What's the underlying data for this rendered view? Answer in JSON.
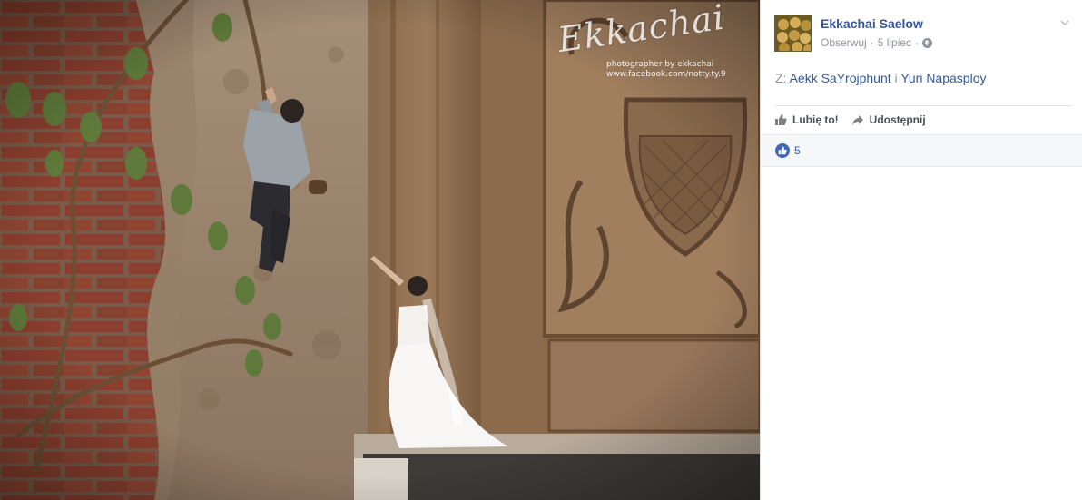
{
  "photo": {
    "watermark_signature": "Ekkachai",
    "watermark_credit": "photographer by ekkachai",
    "watermark_url": "www.facebook.com/notty.ty.9"
  },
  "post": {
    "author": "Ekkachai Saelow",
    "follow_label": "Obserwuj",
    "separator": "·",
    "date": "5 lipiec",
    "with_prefix": "Z:",
    "tagged": [
      "Aekk SaYrojphunt",
      "Yuri Napasploy"
    ],
    "tagged_joiner": "i"
  },
  "actions": {
    "like_label": "Lubię to!",
    "share_label": "Udostępnij"
  },
  "reactions": {
    "like_count": "5"
  },
  "icons": {
    "privacy": "globe-icon",
    "menu": "chevron-down-icon",
    "like": "thumbs-up-icon",
    "share": "share-arrow-icon"
  },
  "colors": {
    "link": "#365899",
    "muted": "#90949c",
    "like_blue": "#4267b2"
  }
}
